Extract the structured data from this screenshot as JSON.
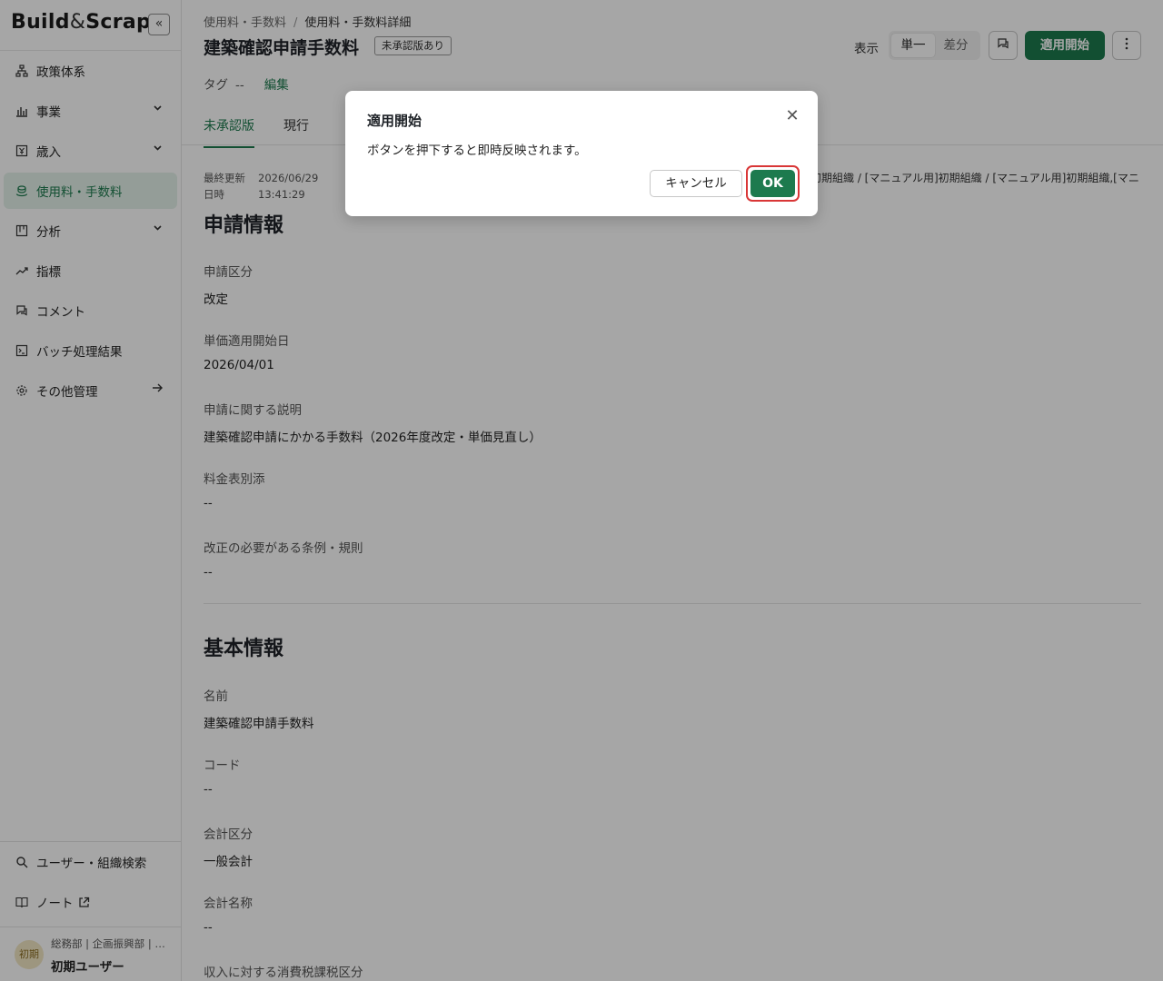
{
  "app": {
    "logo_left": "Build",
    "logo_amp": "&",
    "logo_right": "Scrap",
    "collapse_glyph": "«"
  },
  "sidebar": {
    "items": [
      {
        "label": "政策体系",
        "icon": "hierarchy-icon"
      },
      {
        "label": "事業",
        "icon": "bar-chart-icon",
        "expandable": true
      },
      {
        "label": "歳入",
        "icon": "yen-box-icon",
        "expandable": true
      },
      {
        "label": "使用料・手数料",
        "icon": "coins-icon",
        "active": true
      },
      {
        "label": "分析",
        "icon": "board-icon",
        "expandable": true
      },
      {
        "label": "指標",
        "icon": "trend-icon"
      },
      {
        "label": "コメント",
        "icon": "comment-icon"
      },
      {
        "label": "バッチ処理結果",
        "icon": "terminal-icon"
      },
      {
        "label": "その他管理",
        "icon": "gear-icon",
        "arrow": true
      }
    ],
    "bottom": [
      {
        "label": "ユーザー・組織検索",
        "icon": "search-icon"
      },
      {
        "label": "ノート",
        "icon": "book-icon",
        "external": true
      }
    ],
    "user": {
      "avatar": "初期",
      "org": "総務部 | 企画振興部 | …",
      "name": "初期ユーザー"
    }
  },
  "header": {
    "breadcrumb": [
      "使用料・手数料",
      "使用料・手数料詳細"
    ],
    "breadcrumb_sep": "/",
    "title": "建築確認申請手数料",
    "badge": "未承認版あり",
    "view_label": "表示",
    "view_options": [
      "単一",
      "差分"
    ],
    "apply_button": "適用開始",
    "tag_label": "タグ",
    "tag_value": "--",
    "edit_label": "編集"
  },
  "tabs": [
    "未承認版",
    "現行"
  ],
  "meta": {
    "updated_label_1": "最終更新",
    "updated_label_2": "日時",
    "updated_date": "2026/06/29",
    "updated_time": "13:41:29",
    "org_line": "初期組織 / [マニュアル用]初期組織 / [マニュアル用]初期組織,[マニ"
  },
  "application_info": {
    "title": "申請情報",
    "fields": [
      {
        "label": "申請区分",
        "value": "改定"
      },
      {
        "label": "単価適用開始日",
        "value": "2026/04/01"
      },
      {
        "label": "申請に関する説明",
        "value": "建築確認申請にかかる手数料（2026年度改定・単価見直し）"
      },
      {
        "label": "料金表別添",
        "value": "--"
      },
      {
        "label": "改正の必要がある条例・規則",
        "value": "--"
      }
    ]
  },
  "basic_info": {
    "title": "基本情報",
    "fields": [
      {
        "label": "名前",
        "value": "建築確認申請手数料"
      },
      {
        "label": "コード",
        "value": "--"
      },
      {
        "label": "会計区分",
        "value": "一般会計"
      },
      {
        "label": "会計名称",
        "value": "--"
      },
      {
        "label": "収入に対する消費税課税区分",
        "value": ""
      }
    ]
  },
  "dialog": {
    "title": "適用開始",
    "message": "ボタンを押下すると即時反映されます。",
    "cancel": "キャンセル",
    "ok": "OK",
    "close_glyph": "✕"
  },
  "colors": {
    "brand": "#1d7a4e",
    "highlight": "#d93636",
    "active_bg": "#e4f2ea"
  }
}
